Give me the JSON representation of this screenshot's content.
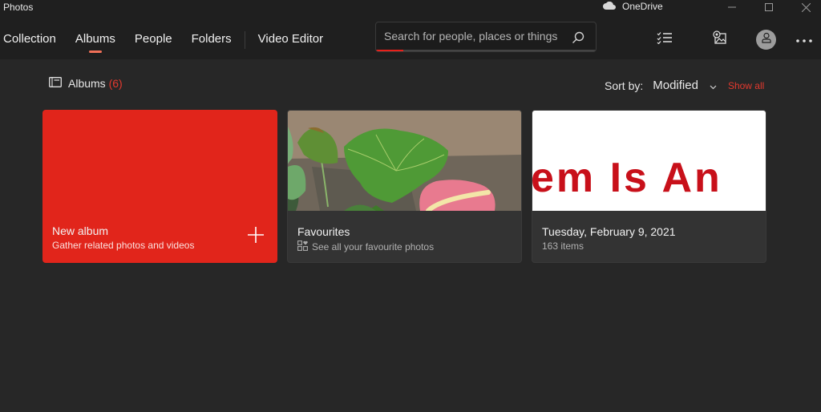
{
  "window": {
    "title": "Photos",
    "onedrive_label": "OneDrive",
    "controls": [
      "minimize",
      "maximize",
      "close"
    ]
  },
  "nav": {
    "tabs": [
      {
        "label": "Collection",
        "active": false
      },
      {
        "label": "Albums",
        "active": true
      },
      {
        "label": "People",
        "active": false
      },
      {
        "label": "Folders",
        "active": false
      },
      {
        "label": "Video Editor",
        "active": false
      }
    ]
  },
  "search": {
    "placeholder": "Search for people, places or things",
    "value": ""
  },
  "toolbar": {
    "icons": [
      "select-icon",
      "import-icon",
      "account-icon",
      "more-icon"
    ]
  },
  "section": {
    "title": "Albums",
    "count": "(6)"
  },
  "sort": {
    "label": "Sort by:",
    "value": "Modified",
    "show_all": "Show all"
  },
  "albums": [
    {
      "title": "New album",
      "subtitle": "Gather related photos and videos",
      "type": "new"
    },
    {
      "title": "Favourites",
      "subtitle": "See all your favourite photos",
      "type": "favourites"
    },
    {
      "title": "Tuesday, February 9, 2021",
      "subtitle": "163 items",
      "type": "date",
      "thumb_text": "em Is An"
    }
  ],
  "colors": {
    "accent": "#e1251b",
    "accent_text": "#e3392e",
    "tab_indicator": "#f07058",
    "background": "#272727",
    "titlebar": "#1f1f1f",
    "card": "#333333"
  }
}
